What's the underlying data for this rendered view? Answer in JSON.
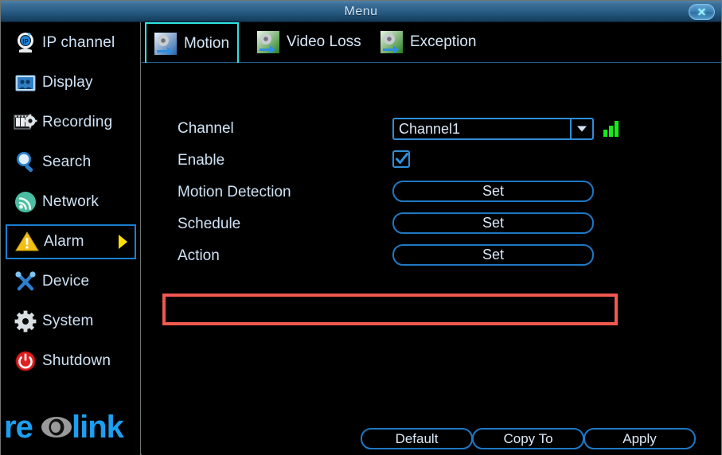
{
  "window": {
    "title": "Menu",
    "close_label": "✕",
    "close_icon": "close-icon"
  },
  "sidebar": {
    "items": [
      {
        "label": "IP channel",
        "icon": "ip-camera-icon",
        "selected": false
      },
      {
        "label": "Display",
        "icon": "display-icon",
        "selected": false
      },
      {
        "label": "Recording",
        "icon": "recording-icon",
        "selected": false
      },
      {
        "label": "Search",
        "icon": "search-icon",
        "selected": false
      },
      {
        "label": "Network",
        "icon": "network-icon",
        "selected": false
      },
      {
        "label": "Alarm",
        "icon": "alarm-warning-icon",
        "selected": true
      },
      {
        "label": "Device",
        "icon": "tools-icon",
        "selected": false
      },
      {
        "label": "System",
        "icon": "gear-icon",
        "selected": false
      },
      {
        "label": "Shutdown",
        "icon": "power-icon",
        "selected": false
      }
    ],
    "logo_text": "reolink"
  },
  "tabs": [
    {
      "label": "Motion",
      "icon": "motion-gear-arrow-icon",
      "active": true
    },
    {
      "label": "Video Loss",
      "icon": "videoloss-gear-arrow-icon",
      "active": false
    },
    {
      "label": "Exception",
      "icon": "exception-gear-arrow-icon",
      "active": false
    }
  ],
  "form": {
    "channel": {
      "label": "Channel",
      "value": "Channel1",
      "dropdown_icon": "chevron-down-icon",
      "signal_icon": "signal-bars-icon"
    },
    "enable": {
      "label": "Enable",
      "checked": true,
      "check_icon": "check-icon"
    },
    "motion_detection": {
      "label": "Motion Detection",
      "button": "Set"
    },
    "schedule": {
      "label": "Schedule",
      "button": "Set"
    },
    "action": {
      "label": "Action",
      "button": "Set",
      "highlighted": true
    }
  },
  "footer": {
    "default_label": "Default",
    "copy_to_label": "Copy To",
    "apply_label": "Apply"
  },
  "colors": {
    "accent_blue": "#1f78c4",
    "tab_active": "#2fe3e3",
    "highlight_red": "#f2584f",
    "text": "#cfe3f5",
    "arrow_yellow": "#ffdf00",
    "signal_green": "#16ec16"
  }
}
